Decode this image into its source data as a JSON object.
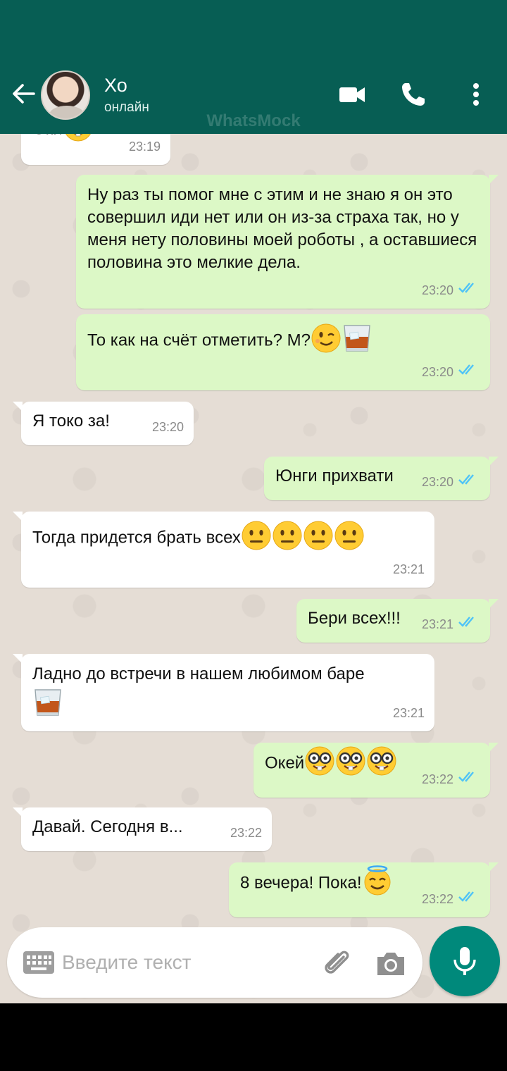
{
  "contact": {
    "name": "Хо",
    "status": "онлайн"
  },
  "watermark": "WhatsMock",
  "icons": {
    "back": "arrow-left-icon",
    "video": "video-camera-icon",
    "call": "phone-icon",
    "more": "more-vertical-icon",
    "keyboard": "keyboard-icon",
    "attach": "paperclip-icon",
    "camera": "camera-icon",
    "mic": "microphone-icon"
  },
  "colors": {
    "header": "#075E54",
    "chat_bg": "#e5ddd5",
    "outgoing_bubble": "#dcf8c6",
    "incoming_bubble": "#ffffff",
    "read_ticks": "#4fc3f7",
    "mic_button": "#00897B"
  },
  "messages": [
    {
      "dir": "in",
      "text": "Оки",
      "emoji": [
        "nerd-face"
      ],
      "time": "23:19"
    },
    {
      "dir": "out",
      "text": "Ну раз ты помог мне с этим и не знаю я он это совершил иди нет или он из-за страха так, но у меня нету половины моей роботы , а оставшиеся половина это мелкие дела.",
      "emoji": [],
      "time": "23:20",
      "read": true
    },
    {
      "dir": "out",
      "text": "То как на счёт отметить? М?",
      "emoji": [
        "winking-face",
        "tumbler-glass"
      ],
      "time": "23:20",
      "read": true
    },
    {
      "dir": "in",
      "text": "Я токо за!",
      "emoji": [],
      "time": "23:20"
    },
    {
      "dir": "out",
      "text": "Юнги прихвати",
      "emoji": [],
      "time": "23:20",
      "read": true
    },
    {
      "dir": "in",
      "text": "Тогда придется брать всех",
      "emoji": [
        "neutral-face",
        "neutral-face",
        "neutral-face",
        "neutral-face"
      ],
      "time": "23:21"
    },
    {
      "dir": "out",
      "text": "Бери всех!!!",
      "emoji": [],
      "time": "23:21",
      "read": true
    },
    {
      "dir": "in",
      "text": "Ладно до встречи в нашем любимом баре",
      "emoji": [
        "tumbler-glass"
      ],
      "time": "23:21"
    },
    {
      "dir": "out",
      "text": "Окей",
      "emoji": [
        "nerd-face",
        "nerd-face",
        "nerd-face"
      ],
      "time": "23:22",
      "read": true
    },
    {
      "dir": "in",
      "text": "Давай. Сегодня в...",
      "emoji": [],
      "time": "23:22"
    },
    {
      "dir": "out",
      "text": "8 вечера! Пока!",
      "emoji": [
        "smiling-face-with-halo"
      ],
      "time": "23:22",
      "read": true
    }
  ],
  "composer": {
    "placeholder": "Введите текст",
    "value": ""
  }
}
